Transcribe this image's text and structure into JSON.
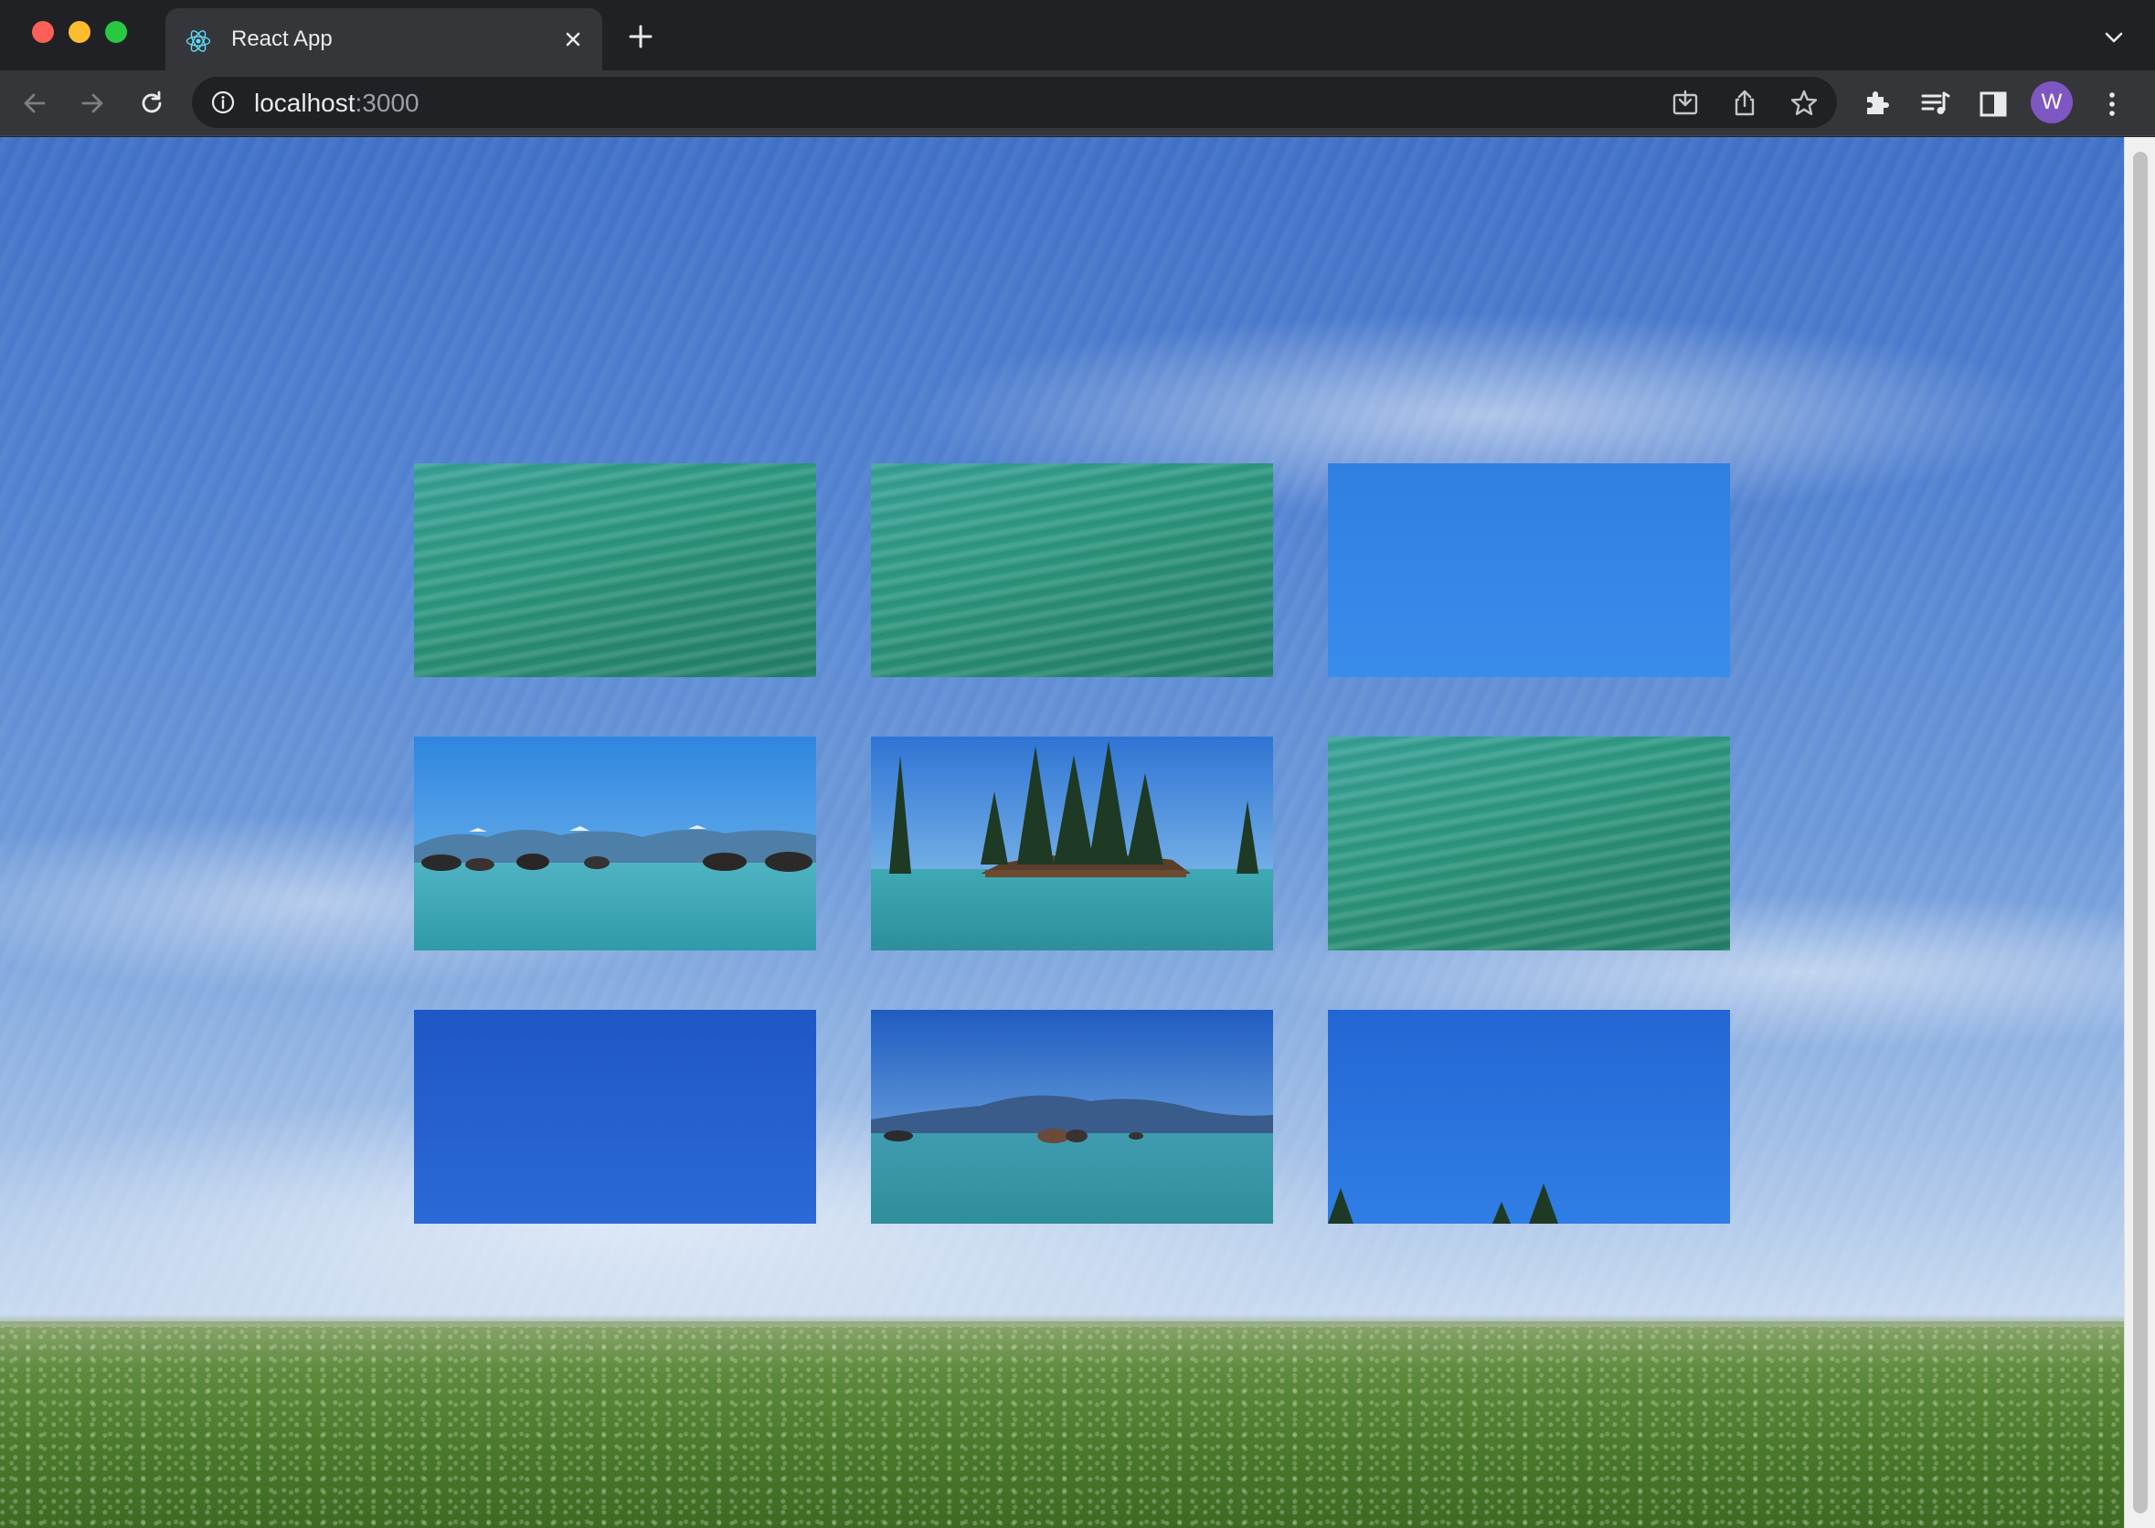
{
  "window": {
    "tab_title": "React App",
    "favicon": "react-logo-icon",
    "new_tab": "plus-icon",
    "tab_search": "chevron-down-icon"
  },
  "toolbar": {
    "url_host": "localhost",
    "url_port": ":3000",
    "profile_initial": "W",
    "icons": [
      "back-arrow-icon",
      "forward-arrow-icon",
      "reload-icon",
      "site-info-icon",
      "install-app-icon",
      "share-icon",
      "bookmark-star-icon",
      "extensions-puzzle-icon",
      "media-controls-icon",
      "side-panel-icon",
      "more-menu-icon"
    ]
  },
  "colors": {
    "avatar": "#7e57c2",
    "tab_bar": "#202124",
    "toolbar": "#35363a",
    "sky_top": "#3d6fc6",
    "grass": "#4a7a2b"
  },
  "page": {
    "background": "sky-and-grass-field-photo",
    "grid": {
      "rows": 3,
      "columns": 3,
      "tiles": [
        {
          "content": "turquoise-water"
        },
        {
          "content": "turquoise-water"
        },
        {
          "content": "blue-sky"
        },
        {
          "content": "lake-with-rocks-and-mountains"
        },
        {
          "content": "lake-island-with-pine-trees"
        },
        {
          "content": "turquoise-water"
        },
        {
          "content": "blue-sky"
        },
        {
          "content": "lake-with-hills-and-rocks"
        },
        {
          "content": "blue-sky-with-treetops"
        }
      ]
    }
  }
}
